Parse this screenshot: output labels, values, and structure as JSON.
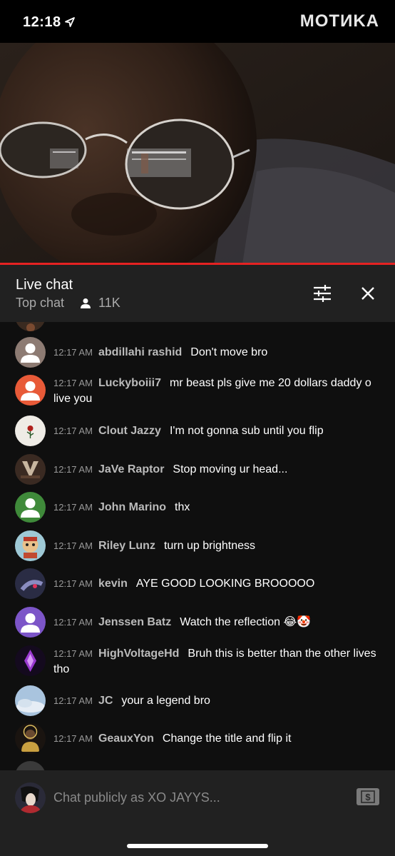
{
  "status_bar": {
    "time": "12:18",
    "watermark": "MOTИKA"
  },
  "header": {
    "title": "Live chat",
    "subtitle": "Top chat",
    "viewers": "11K",
    "icons": [
      "person-icon",
      "filter-icon",
      "close-icon"
    ]
  },
  "messages": [
    {
      "time": "12:17 AM",
      "author": "abdillahi rashid",
      "text": "Don't move bro",
      "avatar": "default-gray"
    },
    {
      "time": "12:17 AM",
      "author": "Luckyboiii7",
      "text": "mr beast pls give me 20 dollars daddy o live you",
      "avatar": "default-orange"
    },
    {
      "time": "12:17 AM",
      "author": "Clout Jazzy",
      "text": "I'm not gonna sub until you flip",
      "avatar": "rose"
    },
    {
      "time": "12:17 AM",
      "author": "JaVe Raptor",
      "text": "Stop moving ur head...",
      "avatar": "logo"
    },
    {
      "time": "12:17 AM",
      "author": "John Marino",
      "text": "thx",
      "avatar": "default-green"
    },
    {
      "time": "12:17 AM",
      "author": "Riley Lunz",
      "text": "turn up brightness",
      "avatar": "cartoon"
    },
    {
      "time": "12:17 AM",
      "author": "kevin",
      "text": "AYE GOOD LOOKING BROOOOO",
      "avatar": "photo-dark"
    },
    {
      "time": "12:17 AM",
      "author": "Jenssen Batz",
      "text": "Watch the reflection 😂🤡",
      "avatar": "default-purple"
    },
    {
      "time": "12:17 AM",
      "author": "HighVoltageHd",
      "text": "Bruh this is better than the other lives tho",
      "avatar": "purple-logo"
    },
    {
      "time": "12:17 AM",
      "author": "JC",
      "text": "your a legend bro",
      "avatar": "sky"
    },
    {
      "time": "12:17 AM",
      "author": "GeauxYon",
      "text": "Change the title and flip it",
      "avatar": "gold-figure"
    }
  ],
  "input": {
    "placeholder": "Chat publicly as XO JAYYS..."
  },
  "colors": {
    "accent": "#e52222",
    "panel": "#212121",
    "background": "#0f0f0f"
  }
}
